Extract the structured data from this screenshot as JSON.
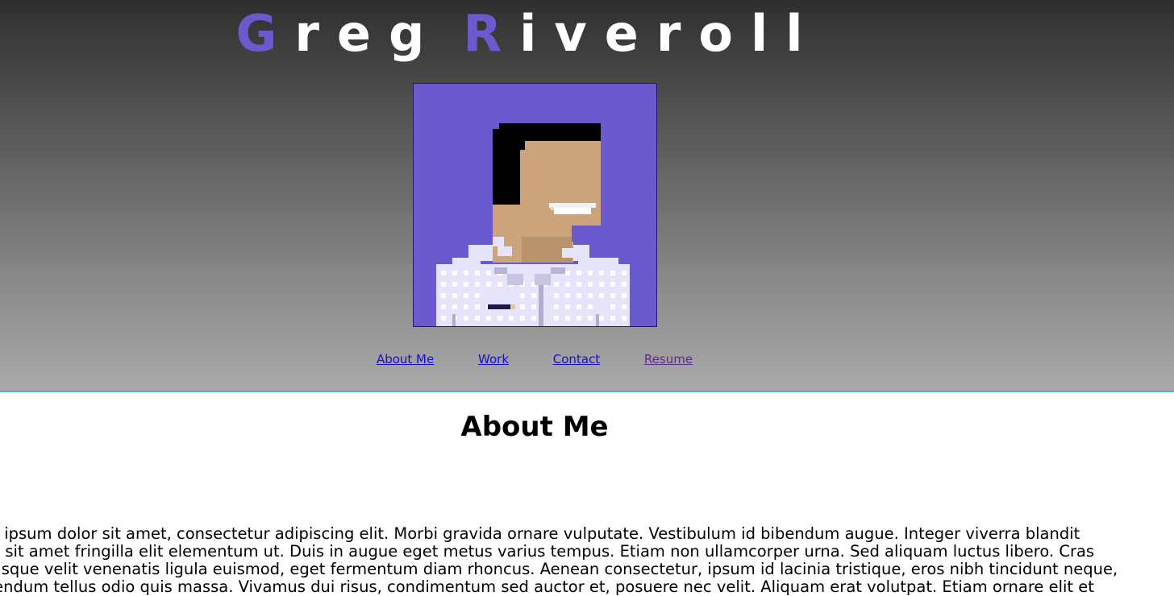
{
  "header": {
    "title_first_initial": "G",
    "title_first_rest": "reg",
    "title_last_initial": "R",
    "title_last_rest": "iveroll",
    "accent_color": "#6a5acd"
  },
  "avatar": {
    "icon": "pixel-portrait-icon",
    "background_color": "#6a5acd"
  },
  "nav": {
    "items": [
      {
        "label": "About Me"
      },
      {
        "label": "Work"
      },
      {
        "label": "Contact"
      },
      {
        "label": "Resume"
      }
    ]
  },
  "about": {
    "heading": "About Me",
    "lines": [
      "Lorem ipsum dolor sit amet, consectetur adipiscing elit. Morbi gravida ornare vulputate. Vestibulum id bibendum augue. Integer viverra blandit",
      "turpis, sit amet fringilla elit elementum ut. Duis in augue eget metus varius tempus. Etiam non ullamcorper urna. Sed aliquam luctus libero. Cras",
      "scelerisque velit venenatis ligula euismod, eget fermentum diam rhoncus. Aenean consectetur, ipsum id lacinia tristique, eros nibh tincidunt neque,",
      "in bibendum tellus odio quis massa. Vivamus dui risus, condimentum sed auctor et, posuere nec velit. Aliquam erat volutpat. Etiam ornare elit et"
    ]
  }
}
